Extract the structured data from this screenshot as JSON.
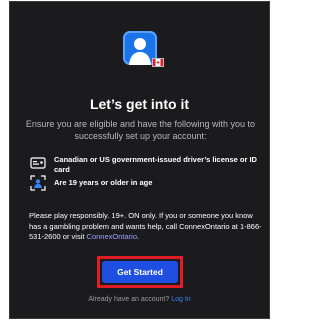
{
  "header": {
    "title": "Let’s get into it",
    "subtitle": "Ensure you are eligible and have the following with you to successfully set up your account:"
  },
  "requirements": [
    {
      "icon": "id-card-icon",
      "label": "Canadian or US government-issued driver’s license or ID card"
    },
    {
      "icon": "age-scan-icon",
      "label": "Are 19 years or older in age"
    }
  ],
  "disclaimer": {
    "text": "Please play responsibly. 19+. ON only. If you or someone you know has a gambling problem and wants help, call ConnexOntario at 1-866-531-2600 or visit",
    "link": "ConnexOntario",
    "end": "."
  },
  "cta": {
    "label": "Get Started"
  },
  "footer": {
    "prompt": "Already have an account?",
    "link": "Log In"
  },
  "colors": {
    "background": "#1b1b1d",
    "primary": "#1f4fe0",
    "highlight": "#e01b24",
    "link": "#3b82f6"
  }
}
